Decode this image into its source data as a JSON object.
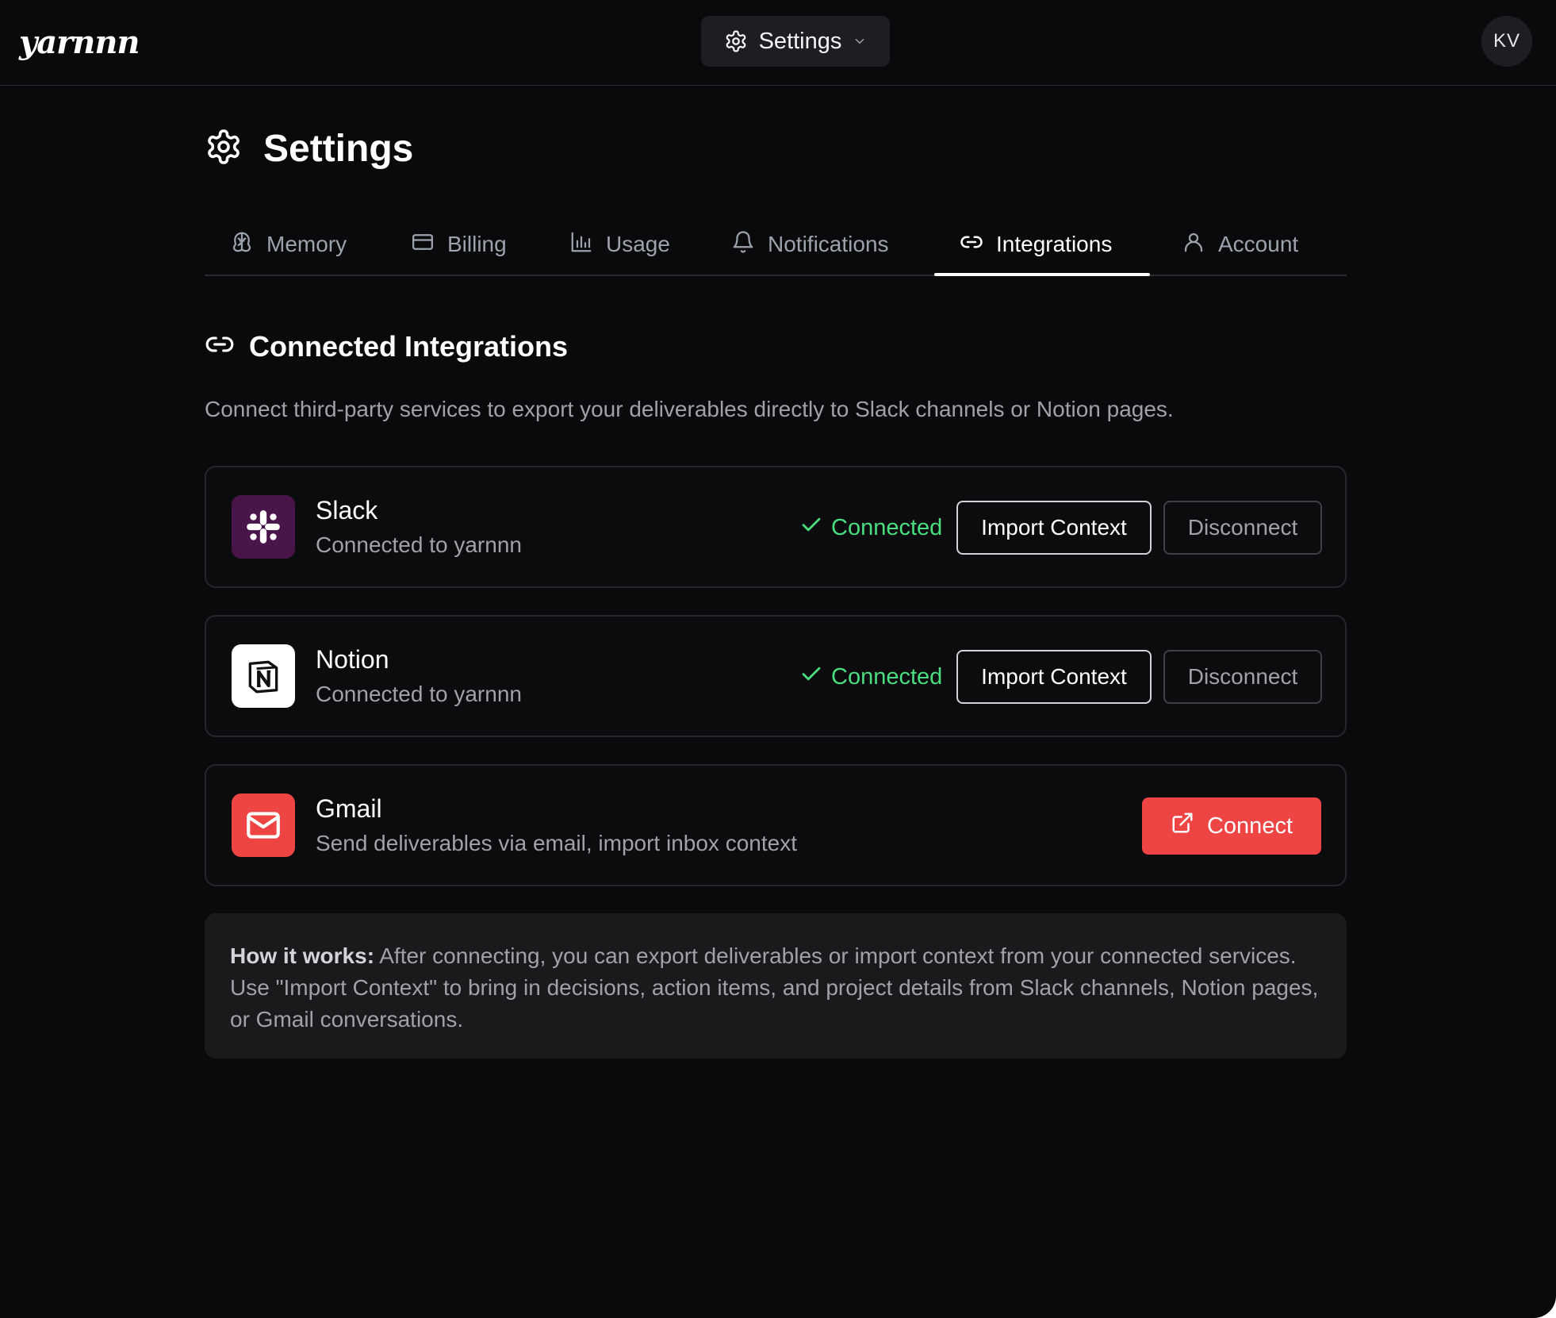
{
  "app": {
    "logo": "yarnnn"
  },
  "topbar": {
    "nav_label": "Settings",
    "avatar_initials": "KV"
  },
  "page": {
    "title": "Settings"
  },
  "tabs": [
    {
      "label": "Memory",
      "icon": "brain-icon",
      "active": false
    },
    {
      "label": "Billing",
      "icon": "credit-card-icon",
      "active": false
    },
    {
      "label": "Usage",
      "icon": "bar-chart-icon",
      "active": false
    },
    {
      "label": "Notifications",
      "icon": "bell-icon",
      "active": false
    },
    {
      "label": "Integrations",
      "icon": "link-icon",
      "active": true
    },
    {
      "label": "Account",
      "icon": "user-icon",
      "active": false
    }
  ],
  "section": {
    "title": "Connected Integrations",
    "description": "Connect third-party services to export your deliverables directly to Slack channels or Notion pages."
  },
  "integrations": [
    {
      "name": "Slack",
      "subtitle": "Connected to yarnnn",
      "status": "Connected",
      "import_label": "Import Context",
      "disconnect_label": "Disconnect",
      "icon": "slack-icon",
      "tile_color": "#4a154b"
    },
    {
      "name": "Notion",
      "subtitle": "Connected to yarnnn",
      "status": "Connected",
      "import_label": "Import Context",
      "disconnect_label": "Disconnect",
      "icon": "notion-icon",
      "tile_color": "#ffffff"
    },
    {
      "name": "Gmail",
      "subtitle": "Send deliverables via email, import inbox context",
      "connect_label": "Connect",
      "icon": "mail-icon",
      "tile_color": "#ef4444"
    }
  ],
  "info": {
    "lead": "How it works:",
    "body": " After connecting, you can export deliverables or import context from your connected services. Use \"Import Context\" to bring in decisions, action items, and project details from Slack channels, Notion pages, or Gmail conversations."
  },
  "colors": {
    "background": "#0a0a0c",
    "connected_green": "#4ade80",
    "connect_red": "#ef4444"
  }
}
